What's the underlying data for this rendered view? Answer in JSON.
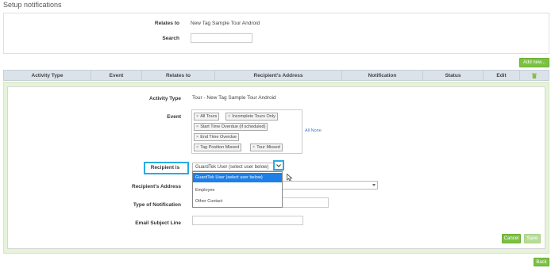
{
  "page": {
    "title": "Setup notifications"
  },
  "filter": {
    "relates_to_label": "Relates to",
    "relates_to_value": "New Tag Sample Tour Android",
    "search_label": "Search",
    "search_value": ""
  },
  "toolbar": {
    "add_new_label": "Add new..."
  },
  "table": {
    "columns": [
      "Activity Type",
      "Event",
      "Relates to",
      "Recipient's Address",
      "Notification",
      "Status",
      "Edit"
    ],
    "delete_all_icon": "trash-icon"
  },
  "form": {
    "activity_type_label": "Activity Type",
    "activity_type_value": "Tour - New Tag Sample Tour Android",
    "event_label": "Event",
    "event_tags": [
      "All Tours",
      "Incomplete Tours Only",
      "Start Time Overdue (if scheduled)",
      "End Time Overdue",
      "Tag Position Missed",
      "Tour Missed"
    ],
    "all_none_label": "All None",
    "recipient_is_label": "Recipient is",
    "recipient_is_value": "GuardTek User (select user below)",
    "recipient_options": [
      "GuardTek User (select user below)",
      "Employee",
      "Other Contact"
    ],
    "recipient_address_label": "Recipient's Address",
    "recipient_address_value": "",
    "type_of_notification_label": "Type of Notification",
    "type_of_notification_value": "",
    "email_subject_label": "Email Subject Line",
    "email_subject_value": "",
    "cancel_label": "Cancel",
    "save_label": "Save"
  },
  "footer": {
    "back_label": "Back"
  },
  "colors": {
    "accent_green": "#7cc142",
    "highlight_blue": "#29abe2",
    "selected_blue": "#1e7fe8",
    "header_bg": "#dbe2ea"
  }
}
